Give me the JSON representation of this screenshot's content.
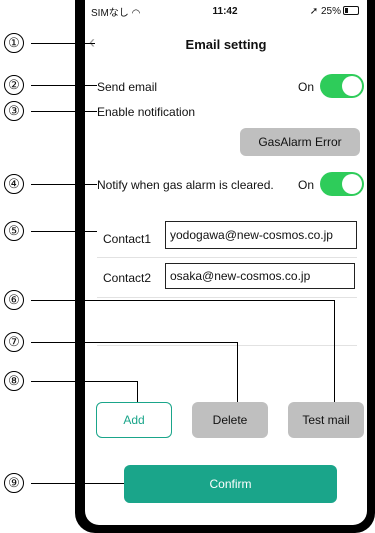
{
  "status_bar": {
    "carrier": "SIMなし",
    "time": "11:42",
    "battery": "25%"
  },
  "navbar": {
    "back_icon": "chevron-left-icon",
    "title": "Email setting"
  },
  "send_email": {
    "label": "Send email",
    "state": "On"
  },
  "enable_notification": {
    "label": "Enable notification",
    "button": "GasAlarm  Error"
  },
  "notify_cleared": {
    "label": "Notify when gas alarm is cleared.",
    "state": "On"
  },
  "contacts": [
    {
      "label": "Contact1",
      "value": "yodogawa@new-cosmos.co.jp"
    },
    {
      "label": "Contact2",
      "value": "osaka@new-cosmos.co.jp"
    }
  ],
  "buttons": {
    "add": "Add",
    "delete": "Delete",
    "test_mail": "Test mail",
    "confirm": "Confirm"
  },
  "markers": [
    "①",
    "②",
    "③",
    "④",
    "⑤",
    "⑥",
    "⑦",
    "⑧",
    "⑨"
  ],
  "colors": {
    "toggle_on": "#2ecc5a",
    "accent": "#1aa58a",
    "gray_button": "#bfbfbf"
  }
}
